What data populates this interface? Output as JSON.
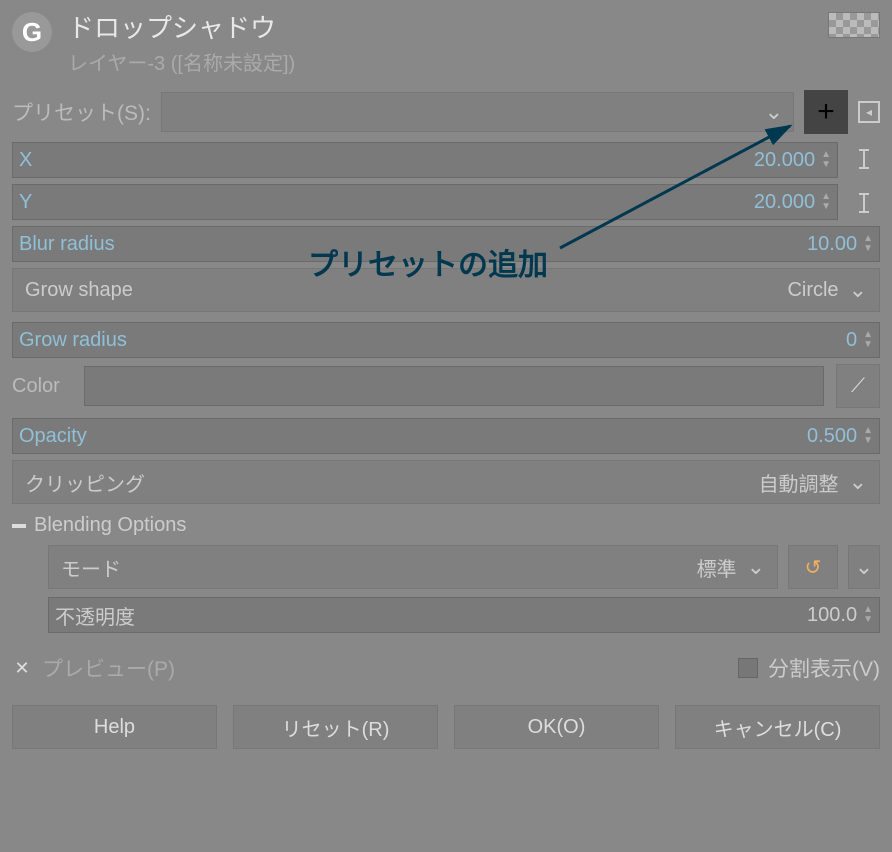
{
  "header": {
    "title": "ドロップシャドウ",
    "subtitle": "レイヤー-3 ([名称未設定])"
  },
  "preset": {
    "label": "プリセット(S):"
  },
  "params": {
    "x": {
      "label": "X",
      "value": "20.000"
    },
    "y": {
      "label": "Y",
      "value": "20.000"
    },
    "blur": {
      "label": "Blur radius",
      "value": "10.00"
    },
    "grow_shape": {
      "label": "Grow shape",
      "value": "Circle"
    },
    "grow_radius": {
      "label": "Grow radius",
      "value": "0"
    },
    "color": {
      "label": "Color"
    },
    "opacity": {
      "label": "Opacity",
      "value": "0.500"
    },
    "clipping": {
      "label": "クリッピング",
      "value": "自動調整"
    }
  },
  "blending": {
    "title": "Blending Options",
    "mode": {
      "label": "モード",
      "value": "標準"
    },
    "opacity": {
      "label": "不透明度",
      "value": "100.0"
    }
  },
  "preview": {
    "label": "プレビュー(P)",
    "split": "分割表示(V)"
  },
  "buttons": {
    "help": "Help",
    "reset": "リセット(R)",
    "ok": "OK(O)",
    "cancel": "キャンセル(C)"
  },
  "annotation": "プリセットの追加"
}
